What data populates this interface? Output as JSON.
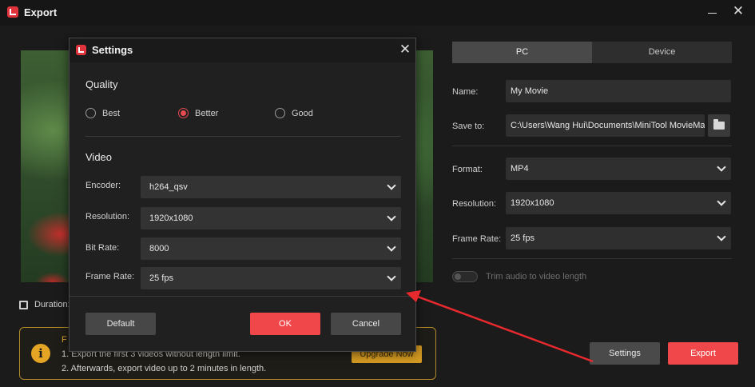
{
  "window": {
    "title": "Export"
  },
  "preview": {
    "duration_label": "Duration:"
  },
  "tabs": [
    {
      "label": "PC",
      "active": true
    },
    {
      "label": "Device",
      "active": false
    }
  ],
  "export_form": {
    "name_label": "Name:",
    "name_value": "My Movie",
    "save_to_label": "Save to:",
    "save_to_value": "C:\\Users\\Wang Hui\\Documents\\MiniTool MovieMaker",
    "format_label": "Format:",
    "format_value": "MP4",
    "resolution_label": "Resolution:",
    "resolution_value": "1920x1080",
    "frame_rate_label": "Frame Rate:",
    "frame_rate_value": "25 fps",
    "trim_label": "Trim audio to video length"
  },
  "info": {
    "title": "F",
    "line1": "1. Export the first 3 videos without length limit.",
    "line2": "2. Afterwards, export video up to 2 minutes in length.",
    "upgrade_label": "Upgrade Now"
  },
  "buttons": {
    "settings": "Settings",
    "export": "Export"
  },
  "settings_dialog": {
    "title": "Settings",
    "quality_title": "Quality",
    "quality_options": [
      "Best",
      "Better",
      "Good"
    ],
    "quality_selected": "Better",
    "video_title": "Video",
    "encoder_label": "Encoder:",
    "encoder_value": "h264_qsv",
    "resolution_label": "Resolution:",
    "resolution_value": "1920x1080",
    "bitrate_label": "Bit Rate:",
    "bitrate_value": "8000",
    "framerate_label": "Frame Rate:",
    "framerate_value": "25 fps",
    "default_label": "Default",
    "ok_label": "OK",
    "cancel_label": "Cancel"
  },
  "colors": {
    "accent": "#f0474a",
    "annotation_arrow": "#e8292e",
    "info_border": "#b08a2a"
  }
}
